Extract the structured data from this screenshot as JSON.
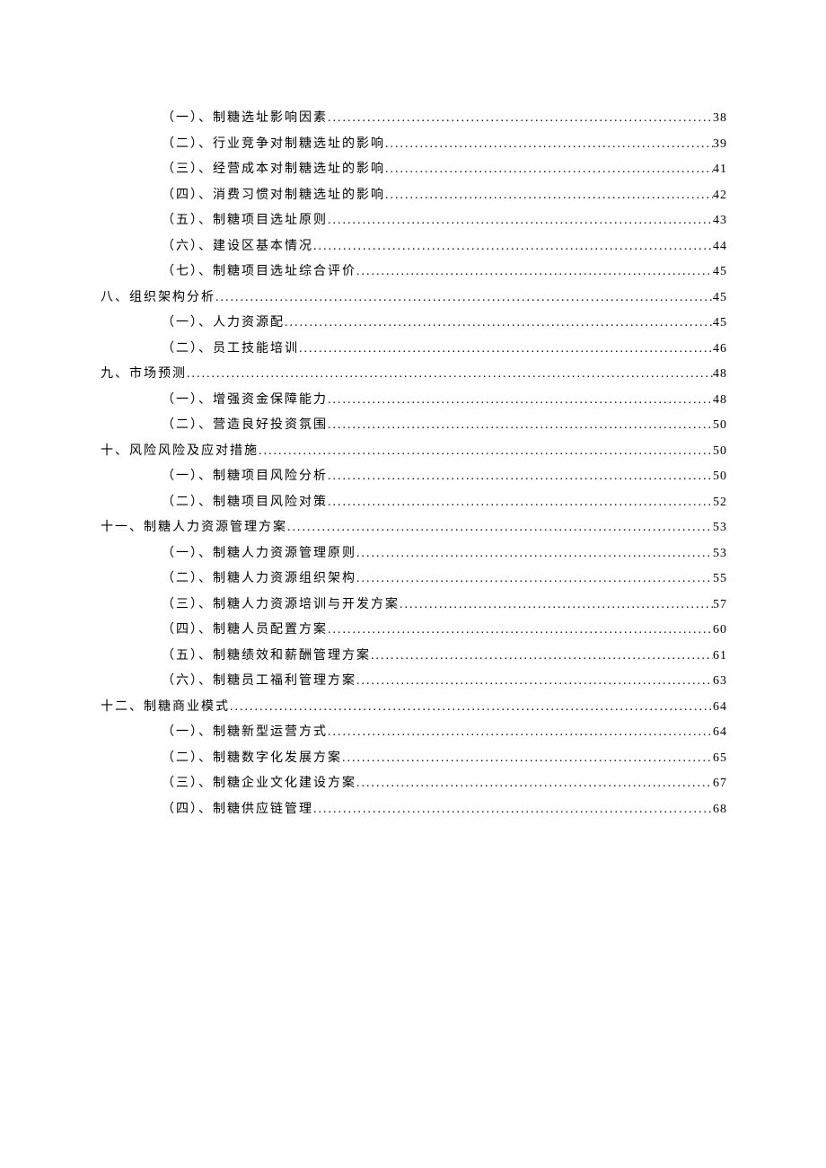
{
  "toc": [
    {
      "level": 2,
      "title": "（一）、制糖选址影响因素",
      "page": "38"
    },
    {
      "level": 2,
      "title": "（二）、行业竞争对制糖选址的影响",
      "page": "39"
    },
    {
      "level": 2,
      "title": "（三）、经营成本对制糖选址的影响",
      "page": "41"
    },
    {
      "level": 2,
      "title": "（四）、消费习惯对制糖选址的影响",
      "page": "42"
    },
    {
      "level": 2,
      "title": "（五）、制糖项目选址原则",
      "page": "43"
    },
    {
      "level": 2,
      "title": "（六）、建设区基本情况",
      "page": "44"
    },
    {
      "level": 2,
      "title": "（七）、制糖项目选址综合评价",
      "page": "45"
    },
    {
      "level": 1,
      "title": "八、组织架构分析",
      "page": "45"
    },
    {
      "level": 2,
      "title": "（一）、人力资源配",
      "page": "45"
    },
    {
      "level": 2,
      "title": "（二）、员工技能培训",
      "page": "46"
    },
    {
      "level": 1,
      "title": "九、市场预测",
      "page": "48"
    },
    {
      "level": 2,
      "title": "（一）、增强资金保障能力",
      "page": "48"
    },
    {
      "level": 2,
      "title": "（二）、营造良好投资氛围",
      "page": "50"
    },
    {
      "level": 1,
      "title": "十、风险风险及应对措施",
      "page": "50"
    },
    {
      "level": 2,
      "title": "（一）、制糖项目风险分析",
      "page": "50"
    },
    {
      "level": 2,
      "title": "（二）、制糖项目风险对策",
      "page": "52"
    },
    {
      "level": 1,
      "title": "十一、制糖人力资源管理方案",
      "page": "53"
    },
    {
      "level": 2,
      "title": "（一）、制糖人力资源管理原则",
      "page": "53"
    },
    {
      "level": 2,
      "title": "（二）、制糖人力资源组织架构",
      "page": "55"
    },
    {
      "level": 2,
      "title": "（三）、制糖人力资源培训与开发方案",
      "page": "57"
    },
    {
      "level": 2,
      "title": "（四）、制糖人员配置方案",
      "page": "60"
    },
    {
      "level": 2,
      "title": "（五）、制糖绩效和薪酬管理方案",
      "page": "61"
    },
    {
      "level": 2,
      "title": "（六）、制糖员工福利管理方案",
      "page": "63"
    },
    {
      "level": 1,
      "title": "十二、制糖商业模式",
      "page": "64"
    },
    {
      "level": 2,
      "title": "（一）、制糖新型运营方式",
      "page": "64"
    },
    {
      "level": 2,
      "title": "（二）、制糖数字化发展方案",
      "page": "65"
    },
    {
      "level": 2,
      "title": "（三）、制糖企业文化建设方案",
      "page": "67"
    },
    {
      "level": 2,
      "title": "（四）、制糖供应链管理",
      "page": "68"
    }
  ]
}
